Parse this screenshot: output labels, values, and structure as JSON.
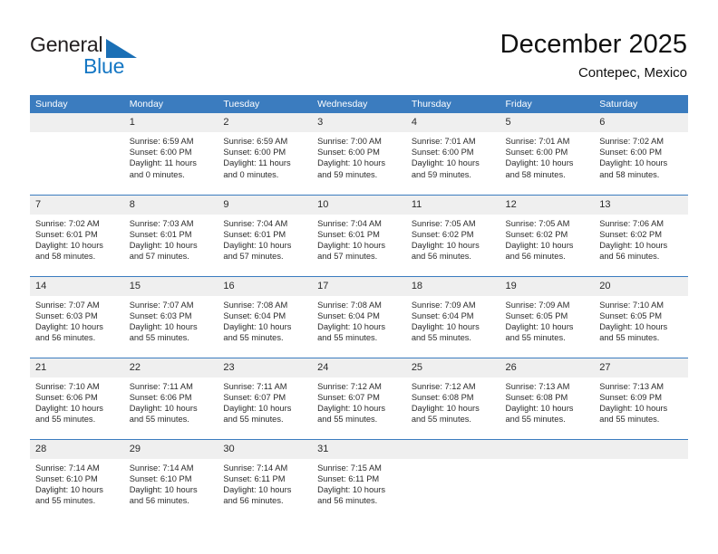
{
  "brand": {
    "name_top": "General",
    "name_bottom": "Blue",
    "triangle_color": "#1a6fb5",
    "blue_color": "#1577c4"
  },
  "header": {
    "title": "December 2025",
    "subtitle": "Contepec, Mexico"
  },
  "colors": {
    "header_blue": "#3b7cbf",
    "daynum_band": "#efefef",
    "text": "#2b2b2b"
  },
  "weekday_headers": [
    "Sunday",
    "Monday",
    "Tuesday",
    "Wednesday",
    "Thursday",
    "Friday",
    "Saturday"
  ],
  "weeks": [
    [
      {
        "day": "",
        "sunrise": "",
        "sunset": "",
        "daylight": ""
      },
      {
        "day": "1",
        "sunrise": "Sunrise: 6:59 AM",
        "sunset": "Sunset: 6:00 PM",
        "daylight": "Daylight: 11 hours and 0 minutes."
      },
      {
        "day": "2",
        "sunrise": "Sunrise: 6:59 AM",
        "sunset": "Sunset: 6:00 PM",
        "daylight": "Daylight: 11 hours and 0 minutes."
      },
      {
        "day": "3",
        "sunrise": "Sunrise: 7:00 AM",
        "sunset": "Sunset: 6:00 PM",
        "daylight": "Daylight: 10 hours and 59 minutes."
      },
      {
        "day": "4",
        "sunrise": "Sunrise: 7:01 AM",
        "sunset": "Sunset: 6:00 PM",
        "daylight": "Daylight: 10 hours and 59 minutes."
      },
      {
        "day": "5",
        "sunrise": "Sunrise: 7:01 AM",
        "sunset": "Sunset: 6:00 PM",
        "daylight": "Daylight: 10 hours and 58 minutes."
      },
      {
        "day": "6",
        "sunrise": "Sunrise: 7:02 AM",
        "sunset": "Sunset: 6:00 PM",
        "daylight": "Daylight: 10 hours and 58 minutes."
      }
    ],
    [
      {
        "day": "7",
        "sunrise": "Sunrise: 7:02 AM",
        "sunset": "Sunset: 6:01 PM",
        "daylight": "Daylight: 10 hours and 58 minutes."
      },
      {
        "day": "8",
        "sunrise": "Sunrise: 7:03 AM",
        "sunset": "Sunset: 6:01 PM",
        "daylight": "Daylight: 10 hours and 57 minutes."
      },
      {
        "day": "9",
        "sunrise": "Sunrise: 7:04 AM",
        "sunset": "Sunset: 6:01 PM",
        "daylight": "Daylight: 10 hours and 57 minutes."
      },
      {
        "day": "10",
        "sunrise": "Sunrise: 7:04 AM",
        "sunset": "Sunset: 6:01 PM",
        "daylight": "Daylight: 10 hours and 57 minutes."
      },
      {
        "day": "11",
        "sunrise": "Sunrise: 7:05 AM",
        "sunset": "Sunset: 6:02 PM",
        "daylight": "Daylight: 10 hours and 56 minutes."
      },
      {
        "day": "12",
        "sunrise": "Sunrise: 7:05 AM",
        "sunset": "Sunset: 6:02 PM",
        "daylight": "Daylight: 10 hours and 56 minutes."
      },
      {
        "day": "13",
        "sunrise": "Sunrise: 7:06 AM",
        "sunset": "Sunset: 6:02 PM",
        "daylight": "Daylight: 10 hours and 56 minutes."
      }
    ],
    [
      {
        "day": "14",
        "sunrise": "Sunrise: 7:07 AM",
        "sunset": "Sunset: 6:03 PM",
        "daylight": "Daylight: 10 hours and 56 minutes."
      },
      {
        "day": "15",
        "sunrise": "Sunrise: 7:07 AM",
        "sunset": "Sunset: 6:03 PM",
        "daylight": "Daylight: 10 hours and 55 minutes."
      },
      {
        "day": "16",
        "sunrise": "Sunrise: 7:08 AM",
        "sunset": "Sunset: 6:04 PM",
        "daylight": "Daylight: 10 hours and 55 minutes."
      },
      {
        "day": "17",
        "sunrise": "Sunrise: 7:08 AM",
        "sunset": "Sunset: 6:04 PM",
        "daylight": "Daylight: 10 hours and 55 minutes."
      },
      {
        "day": "18",
        "sunrise": "Sunrise: 7:09 AM",
        "sunset": "Sunset: 6:04 PM",
        "daylight": "Daylight: 10 hours and 55 minutes."
      },
      {
        "day": "19",
        "sunrise": "Sunrise: 7:09 AM",
        "sunset": "Sunset: 6:05 PM",
        "daylight": "Daylight: 10 hours and 55 minutes."
      },
      {
        "day": "20",
        "sunrise": "Sunrise: 7:10 AM",
        "sunset": "Sunset: 6:05 PM",
        "daylight": "Daylight: 10 hours and 55 minutes."
      }
    ],
    [
      {
        "day": "21",
        "sunrise": "Sunrise: 7:10 AM",
        "sunset": "Sunset: 6:06 PM",
        "daylight": "Daylight: 10 hours and 55 minutes."
      },
      {
        "day": "22",
        "sunrise": "Sunrise: 7:11 AM",
        "sunset": "Sunset: 6:06 PM",
        "daylight": "Daylight: 10 hours and 55 minutes."
      },
      {
        "day": "23",
        "sunrise": "Sunrise: 7:11 AM",
        "sunset": "Sunset: 6:07 PM",
        "daylight": "Daylight: 10 hours and 55 minutes."
      },
      {
        "day": "24",
        "sunrise": "Sunrise: 7:12 AM",
        "sunset": "Sunset: 6:07 PM",
        "daylight": "Daylight: 10 hours and 55 minutes."
      },
      {
        "day": "25",
        "sunrise": "Sunrise: 7:12 AM",
        "sunset": "Sunset: 6:08 PM",
        "daylight": "Daylight: 10 hours and 55 minutes."
      },
      {
        "day": "26",
        "sunrise": "Sunrise: 7:13 AM",
        "sunset": "Sunset: 6:08 PM",
        "daylight": "Daylight: 10 hours and 55 minutes."
      },
      {
        "day": "27",
        "sunrise": "Sunrise: 7:13 AM",
        "sunset": "Sunset: 6:09 PM",
        "daylight": "Daylight: 10 hours and 55 minutes."
      }
    ],
    [
      {
        "day": "28",
        "sunrise": "Sunrise: 7:14 AM",
        "sunset": "Sunset: 6:10 PM",
        "daylight": "Daylight: 10 hours and 55 minutes."
      },
      {
        "day": "29",
        "sunrise": "Sunrise: 7:14 AM",
        "sunset": "Sunset: 6:10 PM",
        "daylight": "Daylight: 10 hours and 56 minutes."
      },
      {
        "day": "30",
        "sunrise": "Sunrise: 7:14 AM",
        "sunset": "Sunset: 6:11 PM",
        "daylight": "Daylight: 10 hours and 56 minutes."
      },
      {
        "day": "31",
        "sunrise": "Sunrise: 7:15 AM",
        "sunset": "Sunset: 6:11 PM",
        "daylight": "Daylight: 10 hours and 56 minutes."
      },
      {
        "day": "",
        "sunrise": "",
        "sunset": "",
        "daylight": ""
      },
      {
        "day": "",
        "sunrise": "",
        "sunset": "",
        "daylight": ""
      },
      {
        "day": "",
        "sunrise": "",
        "sunset": "",
        "daylight": ""
      }
    ]
  ]
}
